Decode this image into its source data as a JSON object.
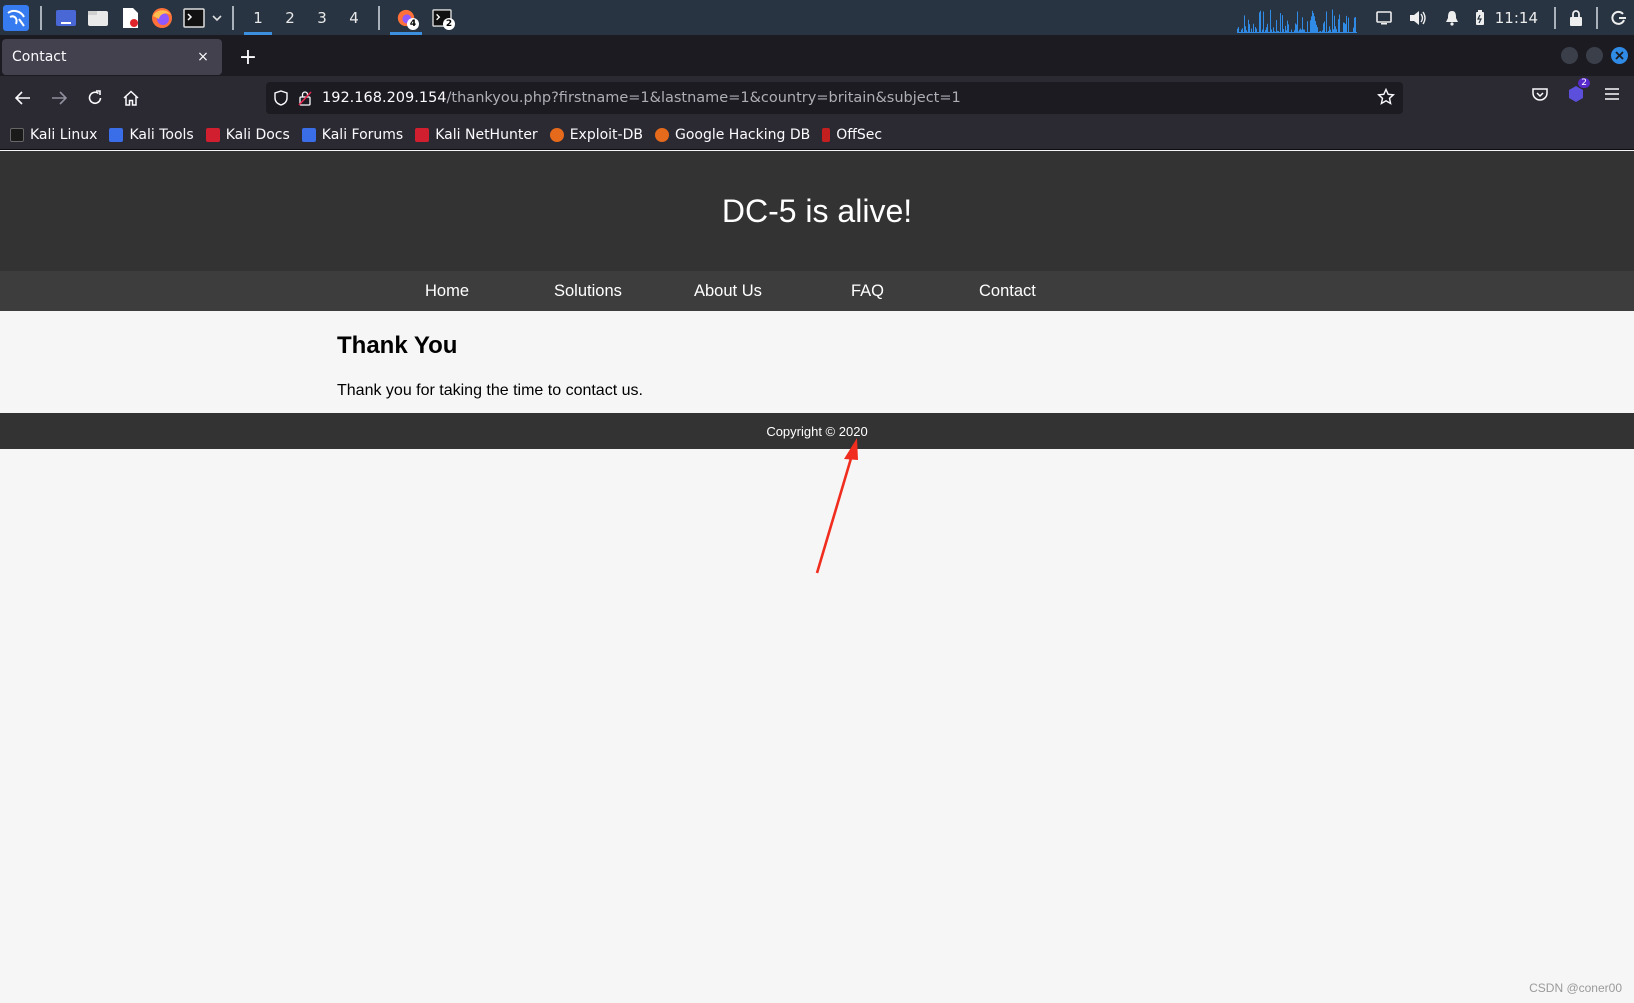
{
  "taskbar": {
    "workspaces": [
      "1",
      "2",
      "3",
      "4"
    ],
    "active_workspace": "1",
    "tasks": [
      {
        "name": "firefox-task",
        "badge": "4"
      },
      {
        "name": "terminal-task",
        "badge": "2"
      }
    ],
    "clock": "11:14"
  },
  "browser": {
    "tab_title": "Contact",
    "tab_close": "×",
    "new_tab": "+",
    "url_host": "192.168.209.154",
    "url_path": "/thankyou.php?firstname=1&lastname=1&country=britain&subject=1",
    "extension_badge": "2"
  },
  "bookmarks": [
    {
      "label": "Kali Linux",
      "color": "#2d2d2d"
    },
    {
      "label": "Kali Tools",
      "color": "#3a6ee8"
    },
    {
      "label": "Kali Docs",
      "color": "#d21f2f"
    },
    {
      "label": "Kali Forums",
      "color": "#3a6ee8"
    },
    {
      "label": "Kali NetHunter",
      "color": "#d21f2f"
    },
    {
      "label": "Exploit-DB",
      "color": "#e66a1c"
    },
    {
      "label": "Google Hacking DB",
      "color": "#e66a1c"
    },
    {
      "label": "OffSec",
      "color": "#c41f1f"
    }
  ],
  "site": {
    "title": "DC-5 is alive!",
    "nav": [
      "Home",
      "Solutions",
      "About Us",
      "FAQ",
      "Contact"
    ],
    "heading": "Thank You",
    "message": "Thank you for taking the time to contact us.",
    "footer": "Copyright © 2020"
  },
  "watermark": "CSDN @coner00"
}
